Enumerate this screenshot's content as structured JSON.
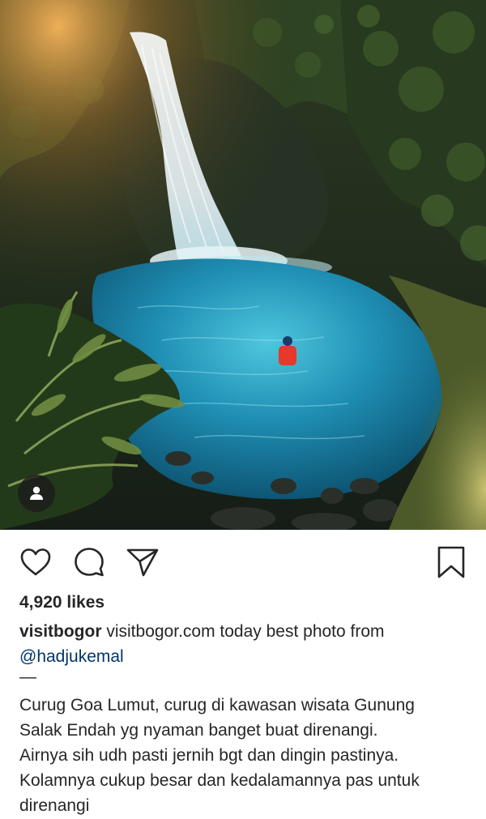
{
  "post": {
    "photo": {
      "subject": "waterfall-photo"
    },
    "actions": {
      "like_icon": "heart-outline-icon",
      "comment_icon": "comment-bubble-icon",
      "share_icon": "paper-plane-icon",
      "save_icon": "bookmark-outline-icon"
    },
    "likes_text": "4,920 likes",
    "caption": {
      "username": "visitbogor",
      "line1_rest": " visitbogor.com today best photo from",
      "mention": "@hadjukemal",
      "dash": "—",
      "body_lines": [
        "Curug Goa Lumut, curug di kawasan wisata Gunung",
        "Salak Endah yg nyaman banget buat direnangi.",
        "Airnya sih udh pasti jernih bgt dan dingin pastinya.",
        "Kolamnya cukup besar dan kedalamannya pas untuk",
        "direnangi"
      ]
    }
  },
  "colors": {
    "text": "#262626",
    "mention": "#003569",
    "background": "#ffffff"
  }
}
